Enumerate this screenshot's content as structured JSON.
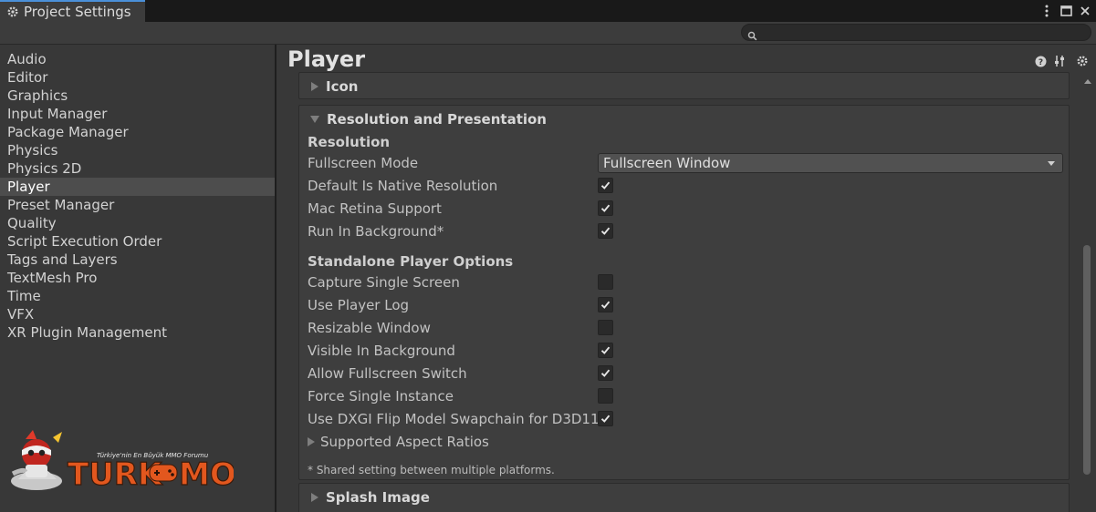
{
  "window": {
    "tab_title": "Project Settings"
  },
  "search": {
    "placeholder": ""
  },
  "sidebar": {
    "items": [
      {
        "label": "Audio"
      },
      {
        "label": "Editor"
      },
      {
        "label": "Graphics"
      },
      {
        "label": "Input Manager"
      },
      {
        "label": "Package Manager"
      },
      {
        "label": "Physics"
      },
      {
        "label": "Physics 2D"
      },
      {
        "label": "Player"
      },
      {
        "label": "Preset Manager"
      },
      {
        "label": "Quality"
      },
      {
        "label": "Script Execution Order"
      },
      {
        "label": "Tags and Layers"
      },
      {
        "label": "TextMesh Pro"
      },
      {
        "label": "Time"
      },
      {
        "label": "VFX"
      },
      {
        "label": "XR Plugin Management"
      }
    ],
    "selected": "Player"
  },
  "logo": {
    "text": "TURKMMO",
    "tagline": "Türkiye'nin En Büyük MMO Forumu"
  },
  "main": {
    "title": "Player",
    "icon_section": {
      "label": "Icon"
    },
    "resolution_section": {
      "label": "Resolution and Presentation",
      "resolution_header": "Resolution",
      "fullscreen_mode": {
        "label": "Fullscreen Mode",
        "value": "Fullscreen Window"
      },
      "default_native": {
        "label": "Default Is Native Resolution",
        "checked": true
      },
      "mac_retina": {
        "label": "Mac Retina Support",
        "checked": true
      },
      "run_background": {
        "label": "Run In Background*",
        "checked": true
      },
      "standalone_header": "Standalone Player Options",
      "capture_single": {
        "label": "Capture Single Screen",
        "checked": false
      },
      "player_log": {
        "label": "Use Player Log",
        "checked": true
      },
      "resizable": {
        "label": "Resizable Window",
        "checked": false
      },
      "visible_bg": {
        "label": "Visible In Background",
        "checked": true
      },
      "allow_fullscreen": {
        "label": "Allow Fullscreen Switch",
        "checked": true
      },
      "force_single": {
        "label": "Force Single Instance",
        "checked": false
      },
      "dxgi": {
        "label": "Use DXGI Flip Model Swapchain for D3D11",
        "checked": true
      },
      "aspect_ratios": {
        "label": "Supported Aspect Ratios"
      },
      "note": "* Shared setting between multiple platforms."
    },
    "splash_section": {
      "label": "Splash Image"
    }
  },
  "colors": {
    "window_bg": "#383838",
    "selected_item": "#4d4d4d",
    "tab_accent": "#4a90d9"
  }
}
